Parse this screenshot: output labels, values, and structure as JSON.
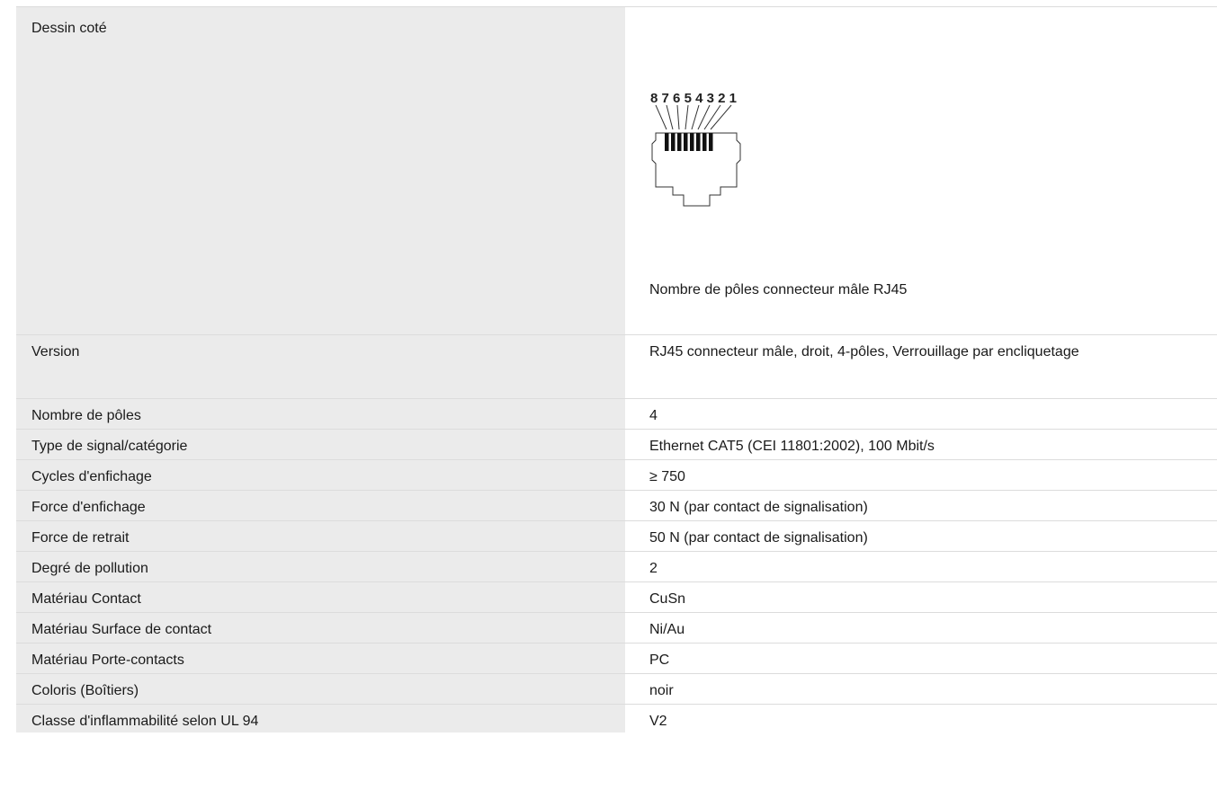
{
  "drawing": {
    "label": "Dessin coté",
    "pin_labels": "8 7 6 5 4 3 2 1",
    "caption": "Nombre de pôles connecteur mâle RJ45"
  },
  "rows": [
    {
      "label": "Version",
      "value": "RJ45 connecteur mâle, droit, 4-pôles, Verrouillage par encliquetage"
    },
    {
      "label": "Nombre de pôles",
      "value": "4"
    },
    {
      "label": "Type de signal/catégorie",
      "value": "Ethernet CAT5 (CEI 11801:2002), 100 Mbit/s"
    },
    {
      "label": "Cycles d'enfichage",
      "value": "≥ 750"
    },
    {
      "label": "Force d'enfichage",
      "value": "30 N (par contact de signalisation)"
    },
    {
      "label": "Force de retrait",
      "value": "50 N (par contact de signalisation)"
    },
    {
      "label": "Degré de pollution",
      "value": "2"
    },
    {
      "label": "Matériau Contact",
      "value": "CuSn"
    },
    {
      "label": "Matériau Surface de contact",
      "value": "Ni/Au"
    },
    {
      "label": "Matériau Porte-contacts",
      "value": "PC"
    },
    {
      "label": "Coloris (Boîtiers)",
      "value": "noir"
    },
    {
      "label": "Classe d'inflammabilité selon UL 94",
      "value": "V2"
    }
  ]
}
